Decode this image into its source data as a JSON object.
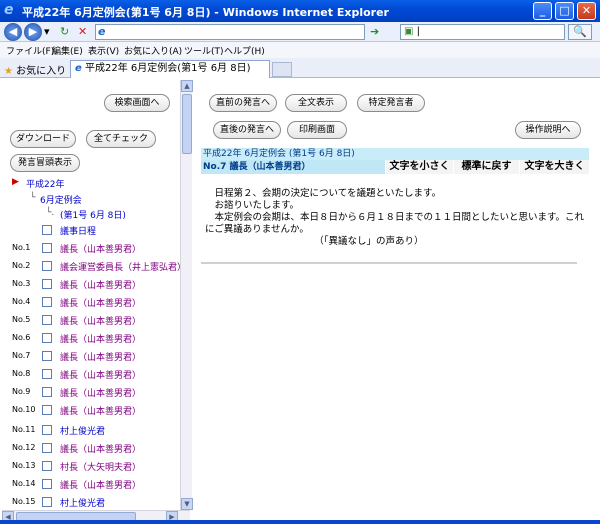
{
  "window": {
    "title": "平成22年 6月定例会(第1号 6月 8日) - Windows Internet Explorer",
    "minimize": "_",
    "maximize": "□",
    "close": "✕"
  },
  "address": {
    "url": "",
    "search_text": "|",
    "back": "◀",
    "forward": "▶",
    "refresh": "↻",
    "stop": "✕",
    "go": "➔",
    "search_glyph": "🔍",
    "dropdown": "▾"
  },
  "menu": {
    "items": [
      "ファイル(F)",
      "編集(E)",
      "表示(V)",
      "お気に入り(A)",
      "ツール(T)",
      "ヘルプ(H)"
    ]
  },
  "favorites": {
    "label": "お気に入り",
    "tab_title": "平成22年 6月定例会(第1号 6月 8日)"
  },
  "left": {
    "search_btn": "検索画面へ",
    "download_btn": "ダウンロード",
    "check_all_btn": "全てチェック",
    "speaker_list_btn": "発言冒頭表示",
    "tree": {
      "year": "平成22年",
      "session": "6月定例会",
      "date": "(第1号 6月 8日)",
      "agenda": "議事日程"
    },
    "rows": [
      {
        "no": "No.1",
        "name": "議長（山本善男君）",
        "style": "purple"
      },
      {
        "no": "No.2",
        "name": "議会運営委員長（井上憲弘君）",
        "style": "purple"
      },
      {
        "no": "No.3",
        "name": "議長（山本善男君）",
        "style": "purple"
      },
      {
        "no": "No.4",
        "name": "議長（山本善男君）",
        "style": "purple"
      },
      {
        "no": "No.5",
        "name": "議長（山本善男君）",
        "style": "purple"
      },
      {
        "no": "No.6",
        "name": "議長（山本善男君）",
        "style": "purple"
      },
      {
        "no": "No.7",
        "name": "議長（山本善男君）",
        "style": "purple"
      },
      {
        "no": "No.8",
        "name": "議長（山本善男君）",
        "style": "purple"
      },
      {
        "no": "No.9",
        "name": "議長（山本善男君）",
        "style": "purple"
      },
      {
        "no": "No.10",
        "name": "議長（山本善男君）",
        "style": "purple"
      },
      {
        "no": "No.11",
        "name": "村上俊光君",
        "style": "blue"
      },
      {
        "no": "No.12",
        "name": "議長（山本善男君）",
        "style": "purple"
      },
      {
        "no": "No.13",
        "name": "村長（大矢明夫君）",
        "style": "purple"
      },
      {
        "no": "No.14",
        "name": "議長（山本善男君）",
        "style": "purple"
      },
      {
        "no": "No.15",
        "name": "村上俊光君",
        "style": "blue"
      }
    ]
  },
  "right": {
    "prev_btn": "直前の発言へ",
    "fulltext_btn": "全文表示",
    "speaker_btn": "特定発言者",
    "next_btn": "直後の発言へ",
    "print_btn": "印刷画面",
    "help_btn": "操作説明へ",
    "meeting": "平成22年 6月定例会 (第1号 6月 8日)",
    "speaker": "No.7 議長（山本善男君）",
    "smaller": "文字を小さく",
    "reset": "標準に戻す",
    "larger": "文字を大きく",
    "body": [
      "　日程第２、会期の決定についてを議題といたします。",
      "　お諮りいたします。",
      "　本定例会の会期は、本日８日から６月１８日までの１１日間としたいと思います。これにご異議ありませんか。",
      "　　　　　　　　　　　　（「異議なし」の声あり）"
    ]
  }
}
